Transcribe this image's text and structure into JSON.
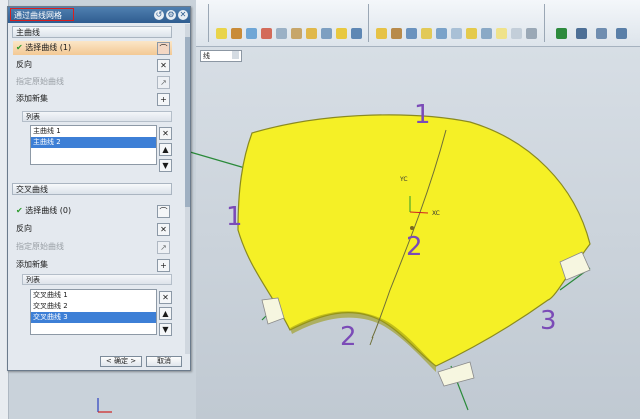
{
  "dialog": {
    "title": "通过曲线网格",
    "main_section": "主曲线",
    "select_main": "选择曲线 (1)",
    "reverse": "反向",
    "specify_origin": "指定原始曲线",
    "add_new": "添加新集",
    "list_label": "列表",
    "main_list": [
      "主曲线 1",
      "主曲线 2"
    ],
    "cross_section": "交叉曲线",
    "select_cross": "选择曲线 (0)",
    "cross_list": [
      "交叉曲线 1",
      "交叉曲线 2",
      "交叉曲线 3"
    ],
    "ok_button": "< 确定 >",
    "cancel_button": "取消"
  },
  "viewport": {
    "filter_value": "线",
    "axis_yc": "YC",
    "axis_xc": "XC",
    "labels": [
      "1",
      "1",
      "2",
      "2",
      "3"
    ]
  },
  "colors": {
    "surface": "#f5f026",
    "title_bar": "#2f5d90",
    "title_highlight": "#d91e1e",
    "selected_row": "#3d7fd6",
    "label_purple": "#7b4bb7"
  }
}
